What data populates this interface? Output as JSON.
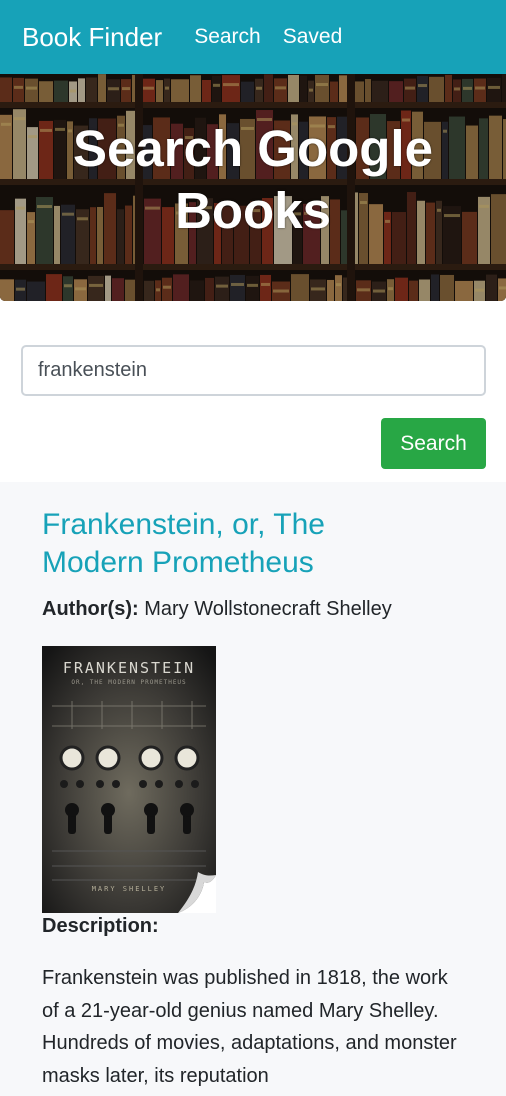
{
  "navbar": {
    "brand": "Book Finder",
    "links": [
      "Search",
      "Saved"
    ]
  },
  "hero": {
    "title": "Search Google Books"
  },
  "search": {
    "value": "frankenstein",
    "button_label": "Search"
  },
  "result": {
    "title": "Frankenstein, or, The Modern Prometheus",
    "authors_label": "Author(s):",
    "authors": "Mary Wollstonecraft Shelley",
    "cover": {
      "title": "FRANKENSTEIN",
      "subtitle": "OR, THE MODERN PROMETHEUS",
      "author": "MARY SHELLEY"
    },
    "description_label": "Description:",
    "description": "Frankenstein was published in 1818, the work of a 21-year-old genius named Mary Shelley. Hundreds of movies, adaptations, and monster masks later, its reputation"
  },
  "colors": {
    "navbar": "#17a2b8",
    "search_button": "#28a745",
    "title_link": "#17a2b8",
    "results_bg": "#f7f8fa"
  }
}
